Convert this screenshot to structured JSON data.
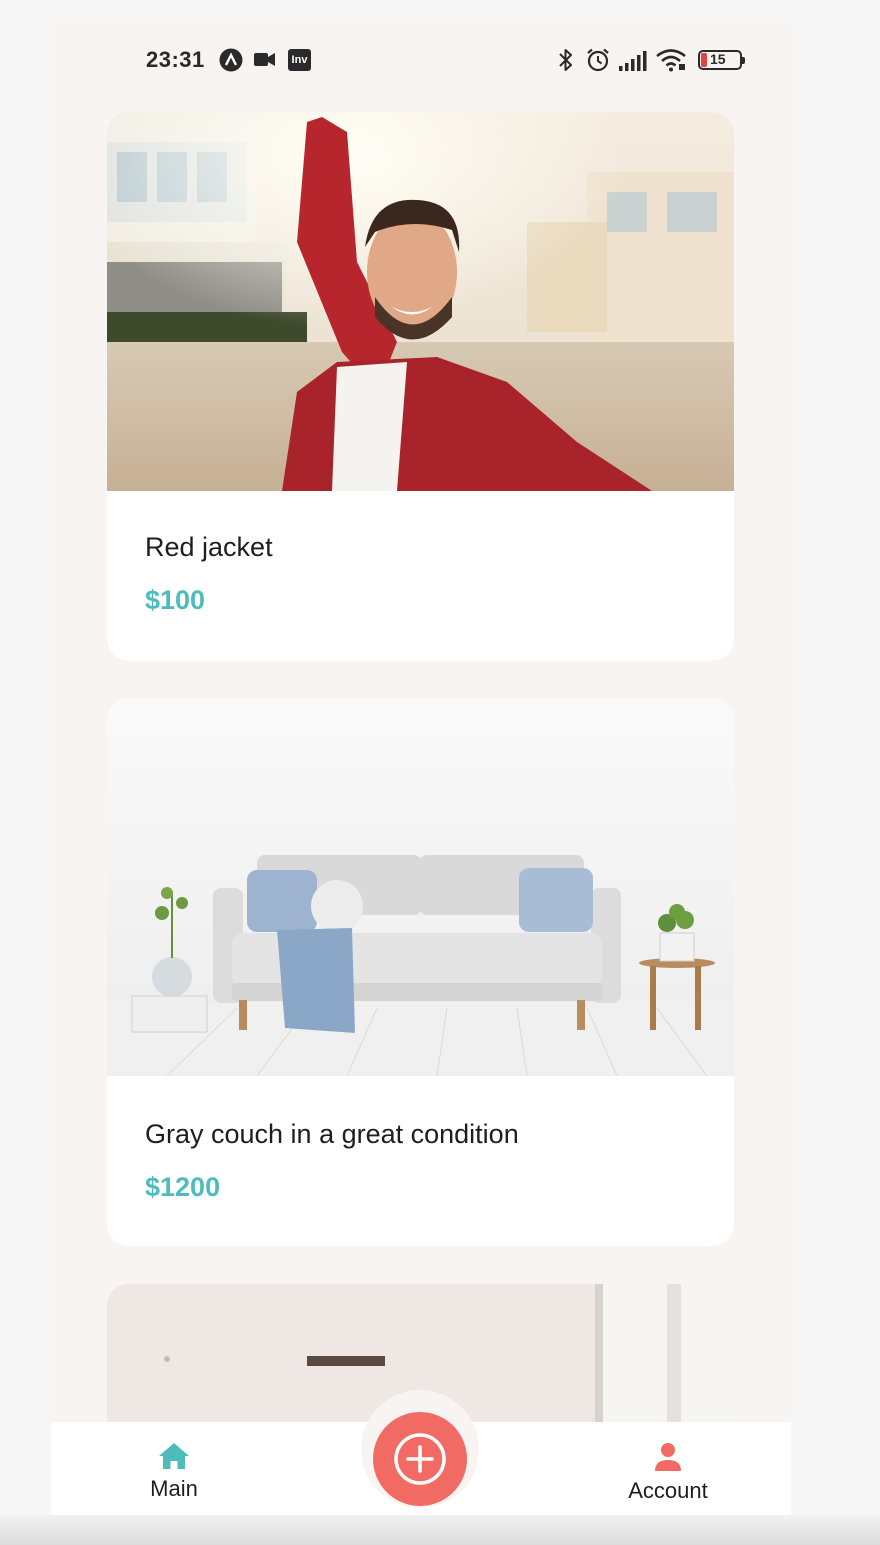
{
  "status_bar": {
    "time": "23:31",
    "app_badge": "Inv",
    "battery_level": "15",
    "icons": [
      "app-a-icon",
      "video-camera-icon",
      "inv-app-icon",
      "bluetooth-icon",
      "alarm-icon",
      "signal-icon",
      "wifi-icon",
      "battery-icon"
    ]
  },
  "listings": [
    {
      "title": "Red jacket",
      "price": "$100",
      "image": "man-red-jacket-selfie-photo"
    },
    {
      "title": "Gray couch in a great condition",
      "price": "$1200",
      "image": "gray-couch-living-room-photo"
    },
    {
      "image": "room-interior-photo"
    }
  ],
  "bottom_nav": {
    "main_label": "Main",
    "account_label": "Account",
    "main_icon": "home-icon",
    "add_icon": "plus-icon",
    "account_icon": "person-icon"
  },
  "colors": {
    "accent_teal": "#4ebcbd",
    "fab_red": "#f26a64",
    "background": "#f8f4f2",
    "card": "#ffffff",
    "text": "#1e1e1e"
  }
}
